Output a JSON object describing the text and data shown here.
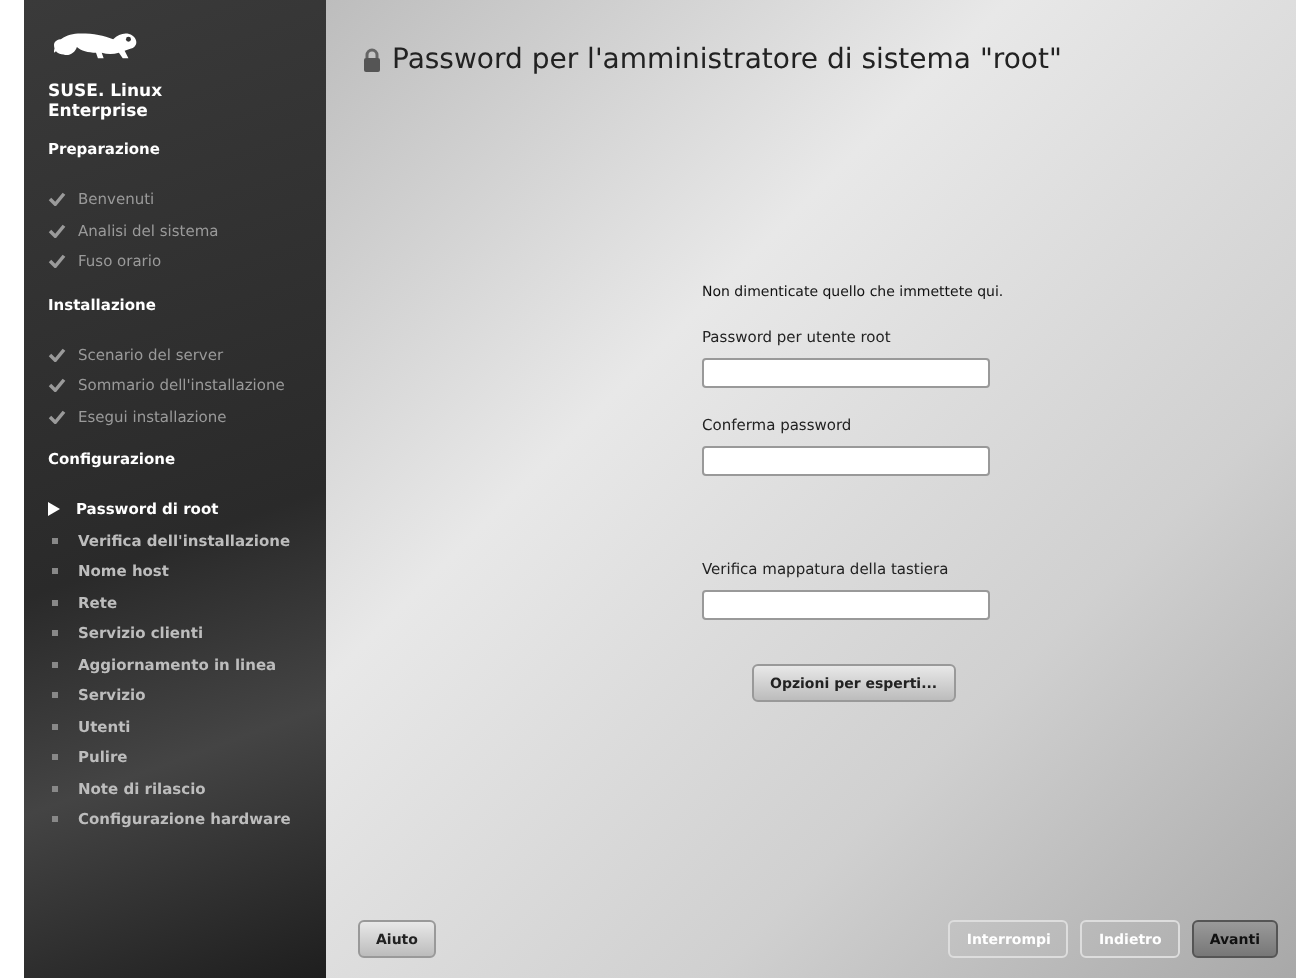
{
  "sidebar": {
    "brand": "SUSE. Linux Enterprise",
    "sections": [
      {
        "title": "Preparazione",
        "items": [
          {
            "label": "Benvenuti",
            "kind": "done"
          },
          {
            "label": "Analisi del sistema",
            "kind": "done"
          },
          {
            "label": "Fuso orario",
            "kind": "done"
          }
        ]
      },
      {
        "title": "Installazione",
        "items": [
          {
            "label": "Scenario del server",
            "kind": "done"
          },
          {
            "label": "Sommario dell'installazione",
            "kind": "done"
          },
          {
            "label": "Esegui installazione",
            "kind": "done"
          }
        ]
      },
      {
        "title": "Configurazione",
        "items": [
          {
            "label": "Password di root",
            "kind": "current"
          },
          {
            "label": "Verifica dell'installazione",
            "kind": "pending"
          },
          {
            "label": "Nome host",
            "kind": "pending"
          },
          {
            "label": "Rete",
            "kind": "pending"
          },
          {
            "label": "Servizio clienti",
            "kind": "pending"
          },
          {
            "label": "Aggiornamento in linea",
            "kind": "pending"
          },
          {
            "label": "Servizio",
            "kind": "pending"
          },
          {
            "label": "Utenti",
            "kind": "pending"
          },
          {
            "label": "Pulire",
            "kind": "pending"
          },
          {
            "label": "Note di rilascio",
            "kind": "pending"
          },
          {
            "label": "Configurazione hardware",
            "kind": "pending"
          }
        ]
      }
    ]
  },
  "page": {
    "title": "Password per l'amministratore di sistema \"root\"",
    "hint": "Non dimenticate quello che immettete qui.",
    "fields": [
      {
        "label": "Password per utente root"
      },
      {
        "label": "Conferma password"
      },
      {
        "label": "Verifica mappatura della tastiera"
      }
    ],
    "expert_button": "Opzioni per esperti..."
  },
  "buttons": {
    "help": "Aiuto",
    "abort": "Interrompi",
    "back": "Indietro",
    "next": "Avanti"
  }
}
